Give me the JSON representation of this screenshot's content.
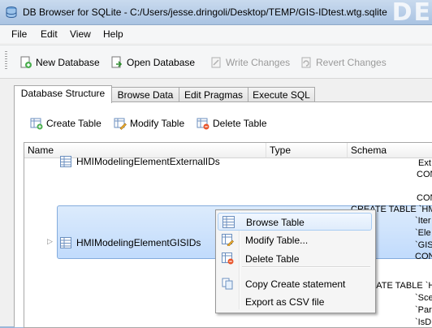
{
  "window": {
    "title": "DB Browser for SQLite - C:/Users/jesse.dringoli/Desktop/TEMP/GIS-IDtest.wtg.sqlite",
    "corner_text": "DE"
  },
  "menu": {
    "file": "File",
    "edit": "Edit",
    "view": "View",
    "help": "Help"
  },
  "toolbar": {
    "new_database": "New Database",
    "open_database": "Open Database",
    "write_changes": "Write Changes",
    "revert_changes": "Revert Changes"
  },
  "tabs": {
    "structure": "Database Structure",
    "browse": "Browse Data",
    "pragmas": "Edit Pragmas",
    "sql": "Execute SQL"
  },
  "structure_toolbar": {
    "create": "Create Table",
    "modify": "Modify Table",
    "delete": "Delete Table"
  },
  "tree": {
    "columns": {
      "name": "Name",
      "type": "Type",
      "schema": "Schema"
    },
    "row_top": {
      "name": "HMIModelingElementExternalIDs",
      "schema_lines": [
        "Ext",
        "CON"
      ]
    },
    "row_sel": {
      "name": "HMIModelingElementGISIDs",
      "schema_lines": [
        "CON",
        "CREATE TABLE `HM",
        "`Iter",
        "`Ele",
        "`GIS",
        "CON"
      ]
    },
    "row_next": {
      "schema_lines": [
        "CREATE TABLE `HM",
        "`Sce",
        "`Par",
        "`IsD"
      ]
    }
  },
  "context_menu": {
    "browse": "Browse Table",
    "modify": "Modify Table...",
    "delete": "Delete Table",
    "copy_create": "Copy Create statement",
    "export_csv": "Export as CSV file"
  },
  "colors": {
    "accent": "#3399ff",
    "selection": "#c1dbfc",
    "titlebar": "#b5cde8"
  }
}
